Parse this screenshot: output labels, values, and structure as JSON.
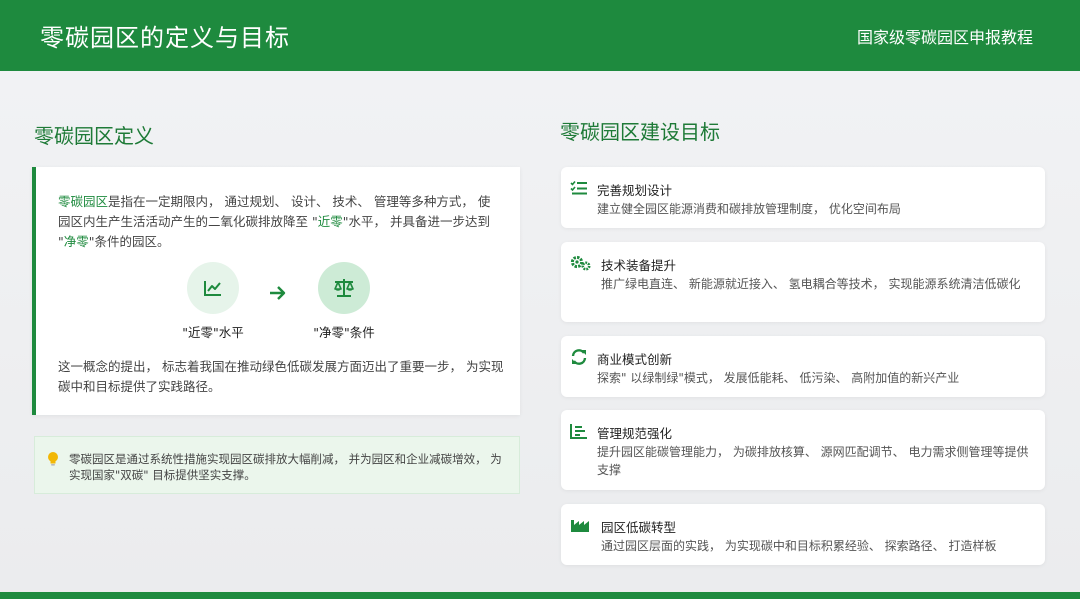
{
  "header": {
    "title": "零碳园区的定义与目标",
    "subtitle": "国家级零碳园区申报教程"
  },
  "definition": {
    "section_title": "零碳园区定义",
    "para1_hl1": "零碳园区",
    "para1_t1": "是指在一定期限内， 通过规划、 设计、 技术、 管理等多种方式， 使园区内生产生活活动产生的二氧化碳排放降至 \"",
    "para1_hl2": "近零",
    "para1_t2": "\"水平， 并具备进一步达到 \"",
    "para1_hl3": "净零",
    "para1_t3": "\"条件的园区。",
    "near_zero_label": "\"近零\"水平",
    "net_zero_label": "\"净零\"条件",
    "para2": "这一概念的提出， 标志着我国在推动绿色低碳发展方面迈出了重要一步， 为实现碳中和目标提供了实践路径。",
    "tip": "零碳园区是通过系统性措施实现园区碳排放大幅削减， 并为园区和企业减碳增效， 为实现国家\"双碳\" 目标提供坚实支撑。"
  },
  "goals": {
    "section_title": "零碳园区建设目标",
    "items": [
      {
        "icon": "checklist-icon",
        "name": "完善规划设计",
        "desc": "建立健全园区能源消费和碳排放管理制度， 优化空间布局"
      },
      {
        "icon": "gears-icon",
        "name": "技术装备提升",
        "desc": "推广绿电直连、 新能源就近接入、 氢电耦合等技术， 实现能源系统清洁低碳化"
      },
      {
        "icon": "cycle-arrows-icon",
        "name": "商业模式创新",
        "desc": "探索\" 以绿制绿\"模式， 发展低能耗、 低污染、 高附加值的新兴产业"
      },
      {
        "icon": "bar-chart-icon",
        "name": "管理规范强化",
        "desc": "提升园区能碳管理能力， 为碳排放核算、 源网匹配调节、 电力需求侧管理等提供支撑"
      },
      {
        "icon": "factory-icon",
        "name": "园区低碳转型",
        "desc": "通过园区层面的实践， 为实现碳中和目标积累经验、 探索路径、 打造样板"
      }
    ]
  },
  "colors": {
    "brand_green": "#1e8a3e",
    "title_green": "#1e7a37",
    "tip_background": "#ebf6ec",
    "bulb_yellow": "#f2b705"
  }
}
